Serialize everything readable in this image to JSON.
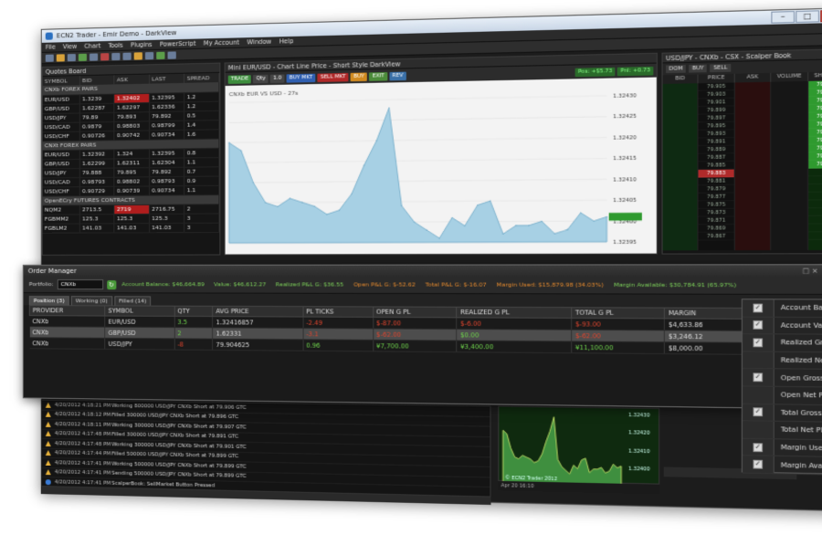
{
  "app": {
    "title": "ECN2 Trader - Emir Demo - DarkView",
    "menu": [
      "File",
      "View",
      "Chart",
      "Tools",
      "Plugins",
      "PowerScript",
      "My Account",
      "Window",
      "Help"
    ]
  },
  "quotes_board": {
    "title": "Quotes Board",
    "columns": [
      "SYMBOL",
      "BID",
      "ASK",
      "LAST",
      "SPREAD"
    ],
    "groups": [
      {
        "name": "CNXb FOREX PAIRS",
        "rows": [
          [
            "EUR/USD",
            "1.3239",
            "1.32402",
            "1.32395",
            "1.2"
          ],
          [
            "GBP/USD",
            "1.62287",
            "1.62297",
            "1.62336",
            "1.2"
          ],
          [
            "USD/JPY",
            "79.89",
            "79.893",
            "79.892",
            "0.5"
          ],
          [
            "USD/CAD",
            "0.9879",
            "0.98803",
            "0.98799",
            "1.4"
          ],
          [
            "USD/CHF",
            "0.90726",
            "0.90742",
            "0.90734",
            "1.6"
          ]
        ]
      },
      {
        "name": "CNXt FOREX PAIRS",
        "rows": [
          [
            "EUR/USD",
            "1.32392",
            "1.324",
            "1.32395",
            "0.8"
          ],
          [
            "GBP/USD",
            "1.62299",
            "1.62311",
            "1.62304",
            "1.1"
          ],
          [
            "USD/JPY",
            "79.888",
            "79.895",
            "79.892",
            "0.7"
          ],
          [
            "USD/CAD",
            "0.98793",
            "0.98802",
            "0.98793",
            "0.9"
          ],
          [
            "USD/CHF",
            "0.90729",
            "0.90739",
            "0.90734",
            "1.1"
          ]
        ]
      },
      {
        "name": "OpenECry FUTURES CONTRACTS",
        "rows": [
          [
            "NQM2",
            "2713.5",
            "2719",
            "2716.75",
            "2"
          ],
          [
            "FGBMM2",
            "125.3",
            "125.3",
            "125.3",
            "3"
          ],
          [
            "FGBLM2",
            "141.03",
            "141.03",
            "141.03",
            "3"
          ]
        ]
      }
    ]
  },
  "chart": {
    "title": "Mini EUR/USD - Chart Line Price - Short Style DarkView",
    "series_label": "CNXb EUR VS USD - 27s",
    "toolbar": {
      "trade": "TRADE",
      "qty_label": "Qty",
      "qty_value": "1.0",
      "buy": "BUY MKT",
      "sell": "SELL MKT",
      "b1": "BUY",
      "b2": "EXIT",
      "b3": "REV",
      "pl1": "Pos: +$5.73",
      "pl2": "Pnl: +0.73"
    }
  },
  "chart_data": {
    "type": "area",
    "title": "CNXb EUR VS USD - 27s",
    "y_ticks": [
      "1.32430",
      "1.32425",
      "1.32420",
      "1.32415",
      "1.32410",
      "1.32405",
      "1.32400",
      "1.32395"
    ],
    "ylim": [
      1.32395,
      1.3243
    ],
    "values": [
      1.3242,
      1.32418,
      1.3241,
      1.32405,
      1.32404,
      1.32406,
      1.32405,
      1.32404,
      1.32402,
      1.32403,
      1.32407,
      1.32414,
      1.3242,
      1.32428,
      1.32404,
      1.324,
      1.32398,
      1.32396,
      1.32401,
      1.32399,
      1.32404,
      1.32405,
      1.32397,
      1.32399,
      1.32399,
      1.324,
      1.32397,
      1.32398,
      1.32402,
      1.324,
      1.32401
    ]
  },
  "dom": {
    "title": "USD/JPY - CNXb - CSX - Scalper Book",
    "tools": [
      "DOM",
      "BUY",
      "SELL"
    ],
    "columns": [
      "BID",
      "PRICE",
      "ASK",
      "VOLUME",
      "SHORTS"
    ],
    "prices": [
      "79.905",
      "79.903",
      "79.901",
      "79.899",
      "79.897",
      "79.895",
      "79.893",
      "79.891",
      "79.889",
      "79.887",
      "79.885",
      "79.883",
      "79.881",
      "79.879",
      "79.877",
      "79.875",
      "79.873",
      "79.871",
      "79.869",
      "79.867"
    ]
  },
  "order_manager": {
    "title": "Order Manager",
    "portfolio_label": "Portfolio:",
    "portfolio_value": "CNXb",
    "stats": [
      {
        "text": "Account Balance: $46,664.89",
        "tone": "g"
      },
      {
        "text": "Value: $46,612.27",
        "tone": "g"
      },
      {
        "text": "Realized P&L G: $36.55",
        "tone": "g"
      },
      {
        "text": "Open P&L G: $-52.62",
        "tone": "o"
      },
      {
        "text": "Total P&L G: $-16.07",
        "tone": "o"
      },
      {
        "text": "Margin Used: $15,879.98 (34.03%)",
        "tone": "o"
      },
      {
        "text": "Margin Available: $30,784.91 (65.97%)",
        "tone": "g"
      }
    ],
    "tabs": [
      "Position (3)",
      "Working (0)",
      "Filled (14)"
    ],
    "columns": [
      "PROVIDER",
      "SYMBOL",
      "QTY",
      "AVG PRICE",
      "PL TICKS",
      "OPEN G PL",
      "REALIZED G PL",
      "TOTAL G PL",
      "MARGIN"
    ],
    "rows": [
      [
        "CNXb",
        "EUR/USD",
        "3.5",
        "1.32416857",
        "-2.49",
        "$-87.00",
        "$-6.00",
        "$-93.00",
        "$4,633.86"
      ],
      [
        "CNXb",
        "GBP/USD",
        "2",
        "1.62331",
        "-3.1",
        "$-62.00",
        "$0.00",
        "$-62.00",
        "$3,246.12"
      ],
      [
        "CNXb",
        "USD/JPY",
        "-8",
        "79.904625",
        "0.96",
        "¥7,700.00",
        "¥3,400.00",
        "¥11,100.00",
        "$8,000.00"
      ]
    ]
  },
  "column_chooser": {
    "items": [
      {
        "label": "Account Balance",
        "checked": true
      },
      {
        "label": "Account Value",
        "checked": true
      },
      {
        "label": "Realized Gross PL",
        "checked": true
      },
      {
        "label": "Realized Net PL",
        "checked": false
      },
      {
        "label": "Open Gross PL",
        "checked": true
      },
      {
        "label": "Open Net PL",
        "checked": false
      },
      {
        "label": "Total Gross PL",
        "checked": true
      },
      {
        "label": "Total Net PL",
        "checked": false
      },
      {
        "label": "Margin Used",
        "checked": true
      },
      {
        "label": "Margin Available",
        "checked": true
      }
    ]
  },
  "log": {
    "rows": [
      {
        "icon": "warn",
        "time": "4/20/2012 4:18:21 PM",
        "text": "Working 800000 USD/JPY CNXb Short at 79.906 GTC"
      },
      {
        "icon": "warn",
        "time": "4/20/2012 4:18:12 PM",
        "text": "Filled 300000 USD/JPY CNXb Short at 79.896 GTC"
      },
      {
        "icon": "warn",
        "time": "4/20/2012 4:18:11 PM",
        "text": "Working 300000 USD/JPY CNXb Short at 79.907 GTC"
      },
      {
        "icon": "warn",
        "time": "4/20/2012 4:17:48 PM",
        "text": "Filled 300000 USD/JPY CNXb Short at 79.891 GTC"
      },
      {
        "icon": "warn",
        "time": "4/20/2012 4:17:48 PM",
        "text": "Working 300000 USD/JPY CNXb Short at 79.901 GTC"
      },
      {
        "icon": "warn",
        "time": "4/20/2012 4:17:44 PM",
        "text": "Filled 500000 USD/JPY CNXb Short at 79.899 GTC"
      },
      {
        "icon": "warn",
        "time": "4/20/2012 4:17:41 PM",
        "text": "Working 500000 USD/JPY CNXb Short at 79.899 GTC"
      },
      {
        "icon": "warn",
        "time": "4/20/2012 4:17:41 PM",
        "text": "Sending 500000 USD/JPY CNXb Short at 79.899 GTC"
      },
      {
        "icon": "info",
        "time": "4/20/2012 4:17:41 PM",
        "text": "ScalperBook: SellMarket Button Pressed"
      }
    ]
  },
  "mini_chart": {
    "label": "© ECN2 Trader 2012",
    "foot": "Apr 20 16:10",
    "y_ticks": [
      "1.32430",
      "1.32420",
      "1.32410",
      "1.32400"
    ]
  }
}
